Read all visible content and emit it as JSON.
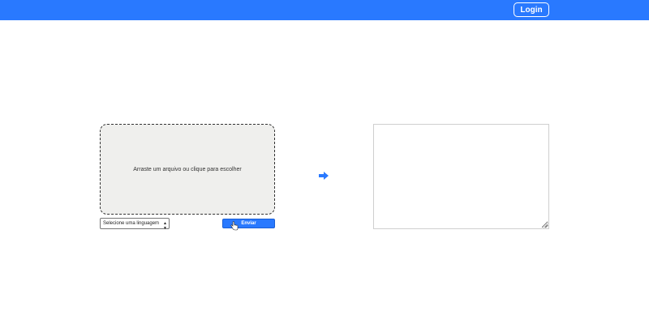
{
  "header": {
    "login_label": "Login",
    "bar_color": "#2979ff"
  },
  "upload": {
    "dropzone_text": "Arraste um arquivo ou clique para escolher",
    "language_select_value": "Selecione uma linguagem",
    "send_label": "Enviar"
  },
  "icons": {
    "arrow": "arrow-right-icon",
    "cursor": "hand-pointer-icon",
    "grip": "resize-grip-icon"
  },
  "output": {
    "value": ""
  }
}
